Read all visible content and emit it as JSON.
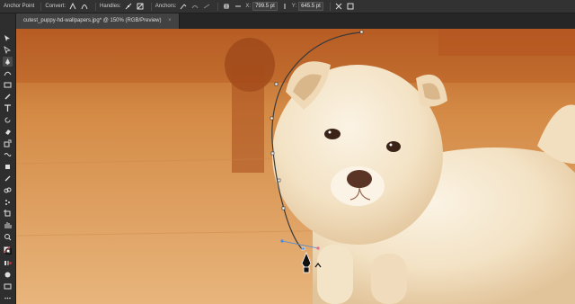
{
  "control_bar": {
    "anchor_point_label": "Anchor Point",
    "convert_label": "Convert:",
    "handles_label": "Handles:",
    "anchors_label": "Anchors:",
    "x_label": "X:",
    "x_value": "799.5 pt",
    "y_label": "Y:",
    "y_value": "645.5 pt"
  },
  "document": {
    "tab_title": "cutest_puppy-hd-wallpapers.jpg* @ 150% (RGB/Preview)",
    "tab_close": "×"
  },
  "icons": {
    "convert_corner": "corner-point-icon",
    "convert_smooth": "smooth-point-icon",
    "handles_show": "show-handles-icon",
    "handles_hide": "hide-handles-icon",
    "anchors_remove": "remove-anchor-icon",
    "anchors_connect": "connect-anchor-icon",
    "anchors_cut": "cut-path-icon",
    "align": "align-icon",
    "transform": "transform-icon",
    "isolate": "isolate-icon",
    "width": "width-icon",
    "height": "height-icon"
  },
  "colors": {
    "ui_dark": "#2e2e2e",
    "ui_bar": "#323232",
    "path_stroke": "#3a3a3a",
    "selection_blue": "#4a8cd8"
  }
}
